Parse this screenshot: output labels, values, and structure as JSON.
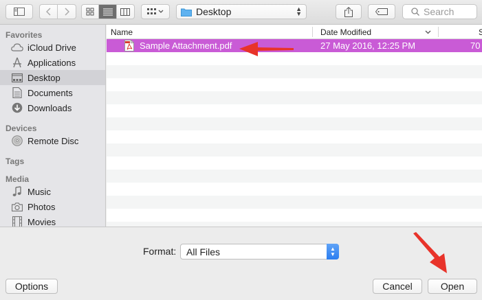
{
  "toolbar": {
    "location": "Desktop",
    "search_placeholder": "Search"
  },
  "sidebar": {
    "sections": [
      {
        "title": "Favorites",
        "items": [
          "iCloud Drive",
          "Applications",
          "Desktop",
          "Documents",
          "Downloads"
        ]
      },
      {
        "title": "Devices",
        "items": [
          "Remote Disc"
        ]
      },
      {
        "title": "Tags",
        "items": []
      },
      {
        "title": "Media",
        "items": [
          "Music",
          "Photos",
          "Movies"
        ]
      }
    ],
    "selected": "Desktop"
  },
  "list": {
    "columns": {
      "name": "Name",
      "date": "Date Modified",
      "size": "S"
    },
    "files": [
      {
        "name": "Sample Attachment.pdf",
        "date": "27 May 2016, 12:25 PM",
        "size": "70"
      }
    ]
  },
  "format": {
    "label": "Format:",
    "value": "All Files"
  },
  "buttons": {
    "options": "Options",
    "cancel": "Cancel",
    "open": "Open"
  },
  "colors": {
    "selection": "#c95bd6",
    "annotation_arrow": "#e8332a",
    "accent_blue": "#2b7ef0"
  }
}
